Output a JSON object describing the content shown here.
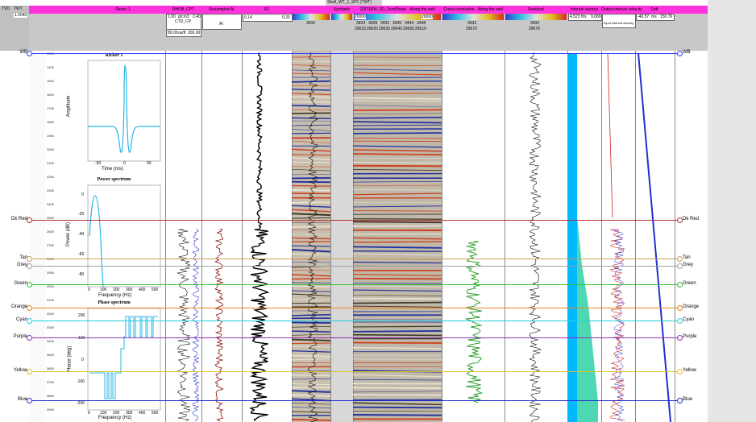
{
  "window": {
    "title": "Shell_WT_1_SP1 (TWT)"
  },
  "axis_headers": {
    "tvd": "TVD",
    "twt": "TWT",
    "twt_value": "1.0040"
  },
  "tracks": [
    {
      "label": "Ricker 1",
      "values": []
    },
    {
      "label": "RHOB_CPT",
      "values": [
        "1.00",
        "g/cm3",
        "2.40",
        "CTD_CP",
        "80.00",
        "us/ft",
        "200.00"
      ]
    },
    {
      "label": "Resampled AI",
      "values": [
        "AI"
      ]
    },
    {
      "label": "RC",
      "values": [
        "0.14",
        "0.20"
      ]
    },
    {
      "label": "",
      "values": [
        "3432"
      ]
    },
    {
      "label": "Synthetic",
      "values": []
    },
    {
      "label": "Q3D1004_3D_ZeroPhase - Along the well",
      "values": [
        "20000",
        "20000",
        "3424",
        "3428",
        "3432",
        "3436",
        "3444",
        "3448",
        "29610",
        "29620",
        "29630",
        "29640",
        "29650",
        "29510"
      ]
    },
    {
      "label": "Cross-correlation - Along the well",
      "values": [
        "3432",
        "29570"
      ]
    },
    {
      "label": "Residual",
      "values": [
        "3432",
        "29670"
      ]
    },
    {
      "label": "Interval velocity",
      "values": [
        "4,523",
        "ft/s",
        "9,089"
      ]
    },
    {
      "label": "Output interval velocity",
      "values": [
        "Input interval velocity"
      ]
    },
    {
      "label": "Drift",
      "values": [
        "-40.57",
        "ms",
        "150.76"
      ]
    }
  ],
  "horizons": [
    {
      "name": "WB",
      "color": "#2a3cff"
    },
    {
      "name": "Dk Red",
      "color": "#b03030"
    },
    {
      "name": "Tan",
      "color": "#c8a060"
    },
    {
      "name": "Grey",
      "color": "#a0a0a0"
    },
    {
      "name": "Green",
      "color": "#30c030"
    },
    {
      "name": "Orange",
      "color": "#f08020"
    },
    {
      "name": "Cyan",
      "color": "#20d0e0"
    },
    {
      "name": "Purple",
      "color": "#9030c0"
    },
    {
      "name": "Yellow",
      "color": "#e0c020"
    },
    {
      "name": "Blue",
      "color": "#2030d0"
    }
  ],
  "twt_ticks": [
    "1300",
    "1400",
    "1500",
    "1600",
    "1700",
    "1800",
    "1900",
    "2000",
    "2100",
    "2200",
    "2300",
    "2400",
    "2500",
    "2600",
    "2700",
    "2800",
    "2900",
    "3000",
    "3100",
    "3200",
    "3300",
    "3400",
    "3500",
    "3600",
    "3700",
    "3800",
    "3900"
  ],
  "wavelet": {
    "ricker": {
      "title": "Ricker 1",
      "xlabel": "Time (ms)",
      "ylabel": "Amplitude",
      "xticks": [
        "-50",
        "0",
        "50"
      ]
    },
    "power": {
      "title": "Power spectrum",
      "xlabel": "Frequency (Hz)",
      "ylabel": "Power (dB)",
      "xticks": [
        "0",
        "100",
        "200",
        "300",
        "400",
        "500"
      ],
      "yticks": [
        "0",
        "-20",
        "-40",
        "-60",
        "-80"
      ]
    },
    "phase": {
      "title": "Phase spectrum",
      "xlabel": "Frequency (Hz)",
      "ylabel": "Phase (deg)",
      "xticks": [
        "0",
        "100",
        "200",
        "300",
        "400",
        "500"
      ],
      "yticks": [
        "200",
        "100",
        "0",
        "-100",
        "-200"
      ]
    }
  },
  "colors": {
    "magenta": "#ff33dd",
    "header_grey": "#c8c8c8",
    "seismic_bg": "#c0b8a8",
    "velocity": "#00b8ff"
  }
}
